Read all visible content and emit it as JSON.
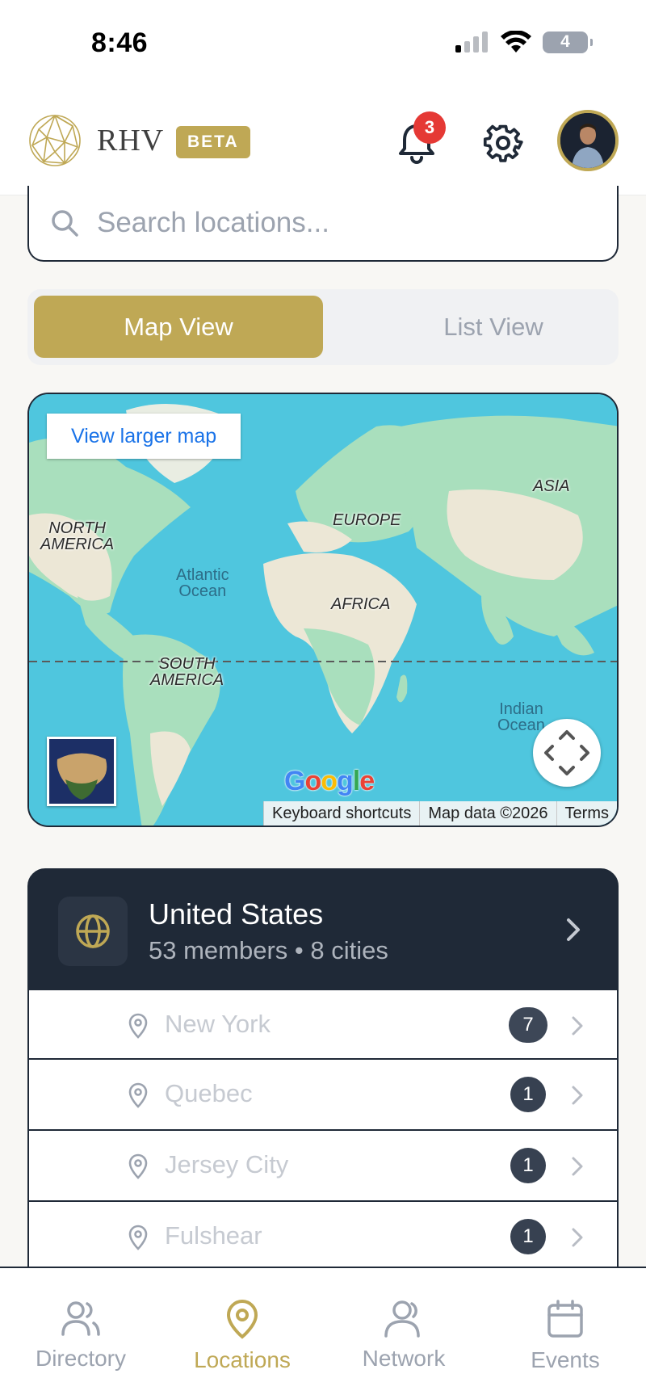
{
  "status_bar": {
    "time": "8:46",
    "battery": "4"
  },
  "header": {
    "brand": "RHV",
    "beta_label": "BETA",
    "notification_count": "3",
    "accent_color": "#bfa855"
  },
  "search": {
    "placeholder": "Search locations..."
  },
  "view_toggle": {
    "map_label": "Map View",
    "list_label": "List View",
    "active": "map"
  },
  "map": {
    "larger_map_label": "View larger map",
    "labels": {
      "north_america_1": "NORTH",
      "north_america_2": "AMERICA",
      "south_america_1": "SOUTH",
      "south_america_2": "AMERICA",
      "europe": "EUROPE",
      "africa": "AFRICA",
      "asia": "ASIA",
      "atlantic_1": "Atlantic",
      "atlantic_2": "Ocean",
      "indian_1": "Indian",
      "indian_2": "Ocean"
    },
    "google_logo": "Google",
    "attribution": {
      "shortcuts": "Keyboard shortcuts",
      "data": "Map data ©2026",
      "terms": "Terms"
    }
  },
  "country": {
    "name": "United States",
    "summary": "53 members • 8 cities"
  },
  "cities": [
    {
      "name": "New York",
      "count": "7"
    },
    {
      "name": "Quebec",
      "count": "1"
    },
    {
      "name": "Jersey City",
      "count": "1"
    },
    {
      "name": "Fulshear",
      "count": "1"
    }
  ],
  "nav": {
    "directory": "Directory",
    "locations": "Locations",
    "network": "Network",
    "events": "Events",
    "active": "locations"
  }
}
